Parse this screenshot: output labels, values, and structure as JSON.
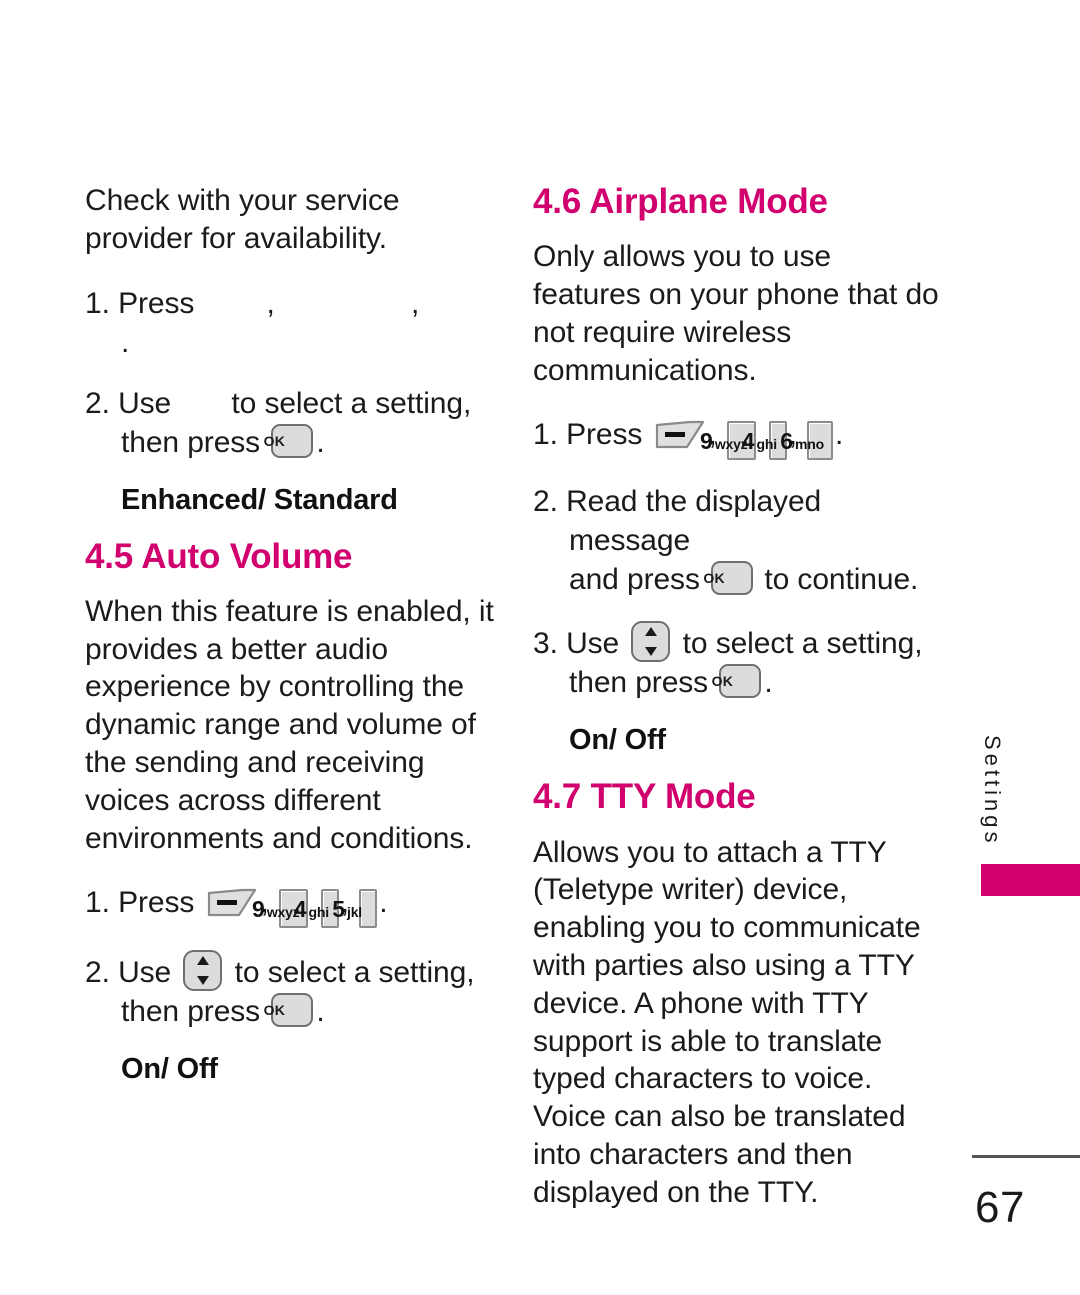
{
  "page": {
    "number": "67",
    "side_tab_label": "Settings",
    "accent_color": "#d1006e",
    "text_color": "#1b1b1b"
  },
  "left_column": {
    "intro_paragraph": "Check with your service provider for availability.",
    "step1": {
      "num": "1.",
      "verb": "Press",
      "sep1": ",",
      "sep2": ",",
      "end": "."
    },
    "step2": {
      "num": "2.",
      "verb": "Use",
      "mid": "to select a setting,",
      "then": "then press",
      "end": "."
    },
    "options_enhanced_standard": "Enhanced/ Standard",
    "section": {
      "heading": "4.5 Auto Volume",
      "paragraph": "When this feature is enabled, it provides a better audio experience by controlling the dynamic range and volume of the sending and receiving voices across different environments and conditions."
    },
    "auto_volume_step1": {
      "num": "1.",
      "verb": "Press",
      "sep1": ",",
      "sep2": ",",
      "end": ".",
      "keys": [
        {
          "type": "soft-key",
          "label": "menu"
        },
        {
          "type": "num-key",
          "digit": "9",
          "letters": "wxyz"
        },
        {
          "type": "num-key",
          "digit": "4",
          "letters": "ghi"
        },
        {
          "type": "num-key",
          "digit": "5",
          "letters": "jkl"
        }
      ]
    },
    "auto_volume_step2": {
      "num": "2.",
      "verb": "Use",
      "mid": "to select a setting,",
      "then": "then press",
      "end": ".",
      "keys": [
        {
          "type": "nav-key",
          "label": "up-down"
        },
        {
          "type": "ok-key",
          "label": "OK"
        }
      ]
    },
    "options_on_off": "On/ Off"
  },
  "right_column": {
    "airplane": {
      "heading": "4.6 Airplane Mode",
      "paragraph": "Only allows you to use features on your phone that do not require wireless communications.",
      "step1": {
        "num": "1.",
        "verb": "Press",
        "sep1": ",",
        "sep2": ",",
        "end": ".",
        "keys": [
          {
            "type": "soft-key",
            "label": "menu"
          },
          {
            "type": "num-key",
            "digit": "9",
            "letters": "wxyz"
          },
          {
            "type": "num-key",
            "digit": "4",
            "letters": "ghi"
          },
          {
            "type": "num-key",
            "digit": "6",
            "letters": "mno"
          }
        ]
      },
      "step2": {
        "num": "2.",
        "lead": "Read the displayed message",
        "mid": "and press",
        "tail": "to continue.",
        "keys": [
          {
            "type": "ok-key",
            "label": "OK"
          }
        ]
      },
      "step3": {
        "num": "3.",
        "verb": "Use",
        "mid": "to select a setting,",
        "then": "then press",
        "end": ".",
        "keys": [
          {
            "type": "nav-key",
            "label": "up-down"
          },
          {
            "type": "ok-key",
            "label": "OK"
          }
        ]
      },
      "options_on_off": "On/ Off"
    },
    "tty": {
      "heading": "4.7 TTY Mode",
      "paragraph": "Allows you to attach a TTY (Teletype writer) device, enabling you to communicate with parties also using a TTY device. A phone with TTY support is able to translate typed characters to voice. Voice can also be translated into characters and then displayed on the TTY."
    }
  },
  "keys": {
    "k9": {
      "digit": "9",
      "letters": "wxyz"
    },
    "k4": {
      "digit": "4",
      "letters": "ghi"
    },
    "k5": {
      "digit": "5",
      "letters": "jkl"
    },
    "k6": {
      "digit": "6",
      "letters": "mno"
    },
    "ok": {
      "label": "OK"
    }
  }
}
